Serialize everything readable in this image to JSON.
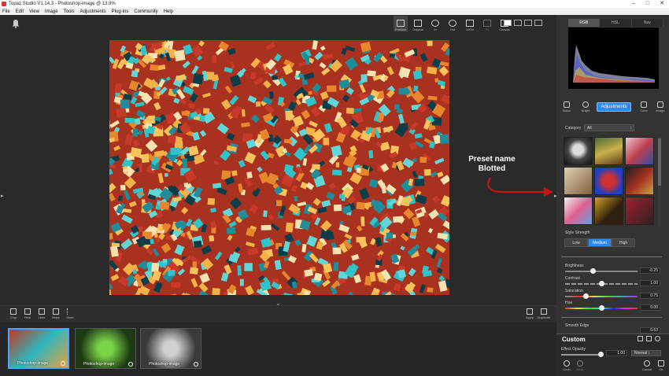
{
  "window": {
    "title": "Topaz Studio V1.14.3 - Photoshop-image @ 13.9%"
  },
  "menu": [
    "File",
    "Edit",
    "View",
    "Image",
    "Tools",
    "Adjustments",
    "Plug-ins",
    "Community",
    "Help"
  ],
  "view_tools": [
    "Preview",
    "Original",
    "In",
    "Out",
    "100%",
    "Fit",
    "Canvas"
  ],
  "bottom_tools": [
    "Crop",
    "Heal",
    "Lens",
    "Mask",
    "More"
  ],
  "apply_tools": [
    "Apply",
    "Duplicate"
  ],
  "filmstrip": [
    {
      "label": "Photoshop-image",
      "selected": true
    },
    {
      "label": "Photoshop-image",
      "selected": false
    },
    {
      "label": "Photoshop-image",
      "selected": false
    }
  ],
  "annotation": {
    "line1": "Preset name",
    "line2": "Blotted"
  },
  "histogram_tabs": [
    "RGB",
    "HSL",
    "Nav"
  ],
  "mode_tabs": [
    "Basic",
    "Bright",
    "Adjustments",
    "Color",
    "Image"
  ],
  "category": {
    "label": "Category",
    "value": "All"
  },
  "style_strength": {
    "label": "Style Strength",
    "options": [
      "Low",
      "Medium",
      "High"
    ],
    "selected": "Medium"
  },
  "sliders": [
    {
      "name": "Brightness",
      "value": "-0.25",
      "level": 0.38
    },
    {
      "name": "Contrast",
      "value": "1.00",
      "level": 0.5
    },
    {
      "name": "Saturation",
      "value": "0.75",
      "level": 0.28
    },
    {
      "name": "Hue",
      "value": "0.00",
      "level": 0.5
    },
    {
      "name": "Smooth Edge",
      "value": "0.53",
      "level": 0.3
    }
  ],
  "custom": {
    "title": "Custom",
    "opacity_label": "Effect Opacity",
    "opacity_value": "1.00",
    "blend_mode": "Normal",
    "actions": [
      "Undo",
      "Redo",
      "Cancel",
      "Ok"
    ]
  },
  "colors": {
    "accent": "#2d89ef",
    "annotation_arrow": "#cc1111"
  }
}
